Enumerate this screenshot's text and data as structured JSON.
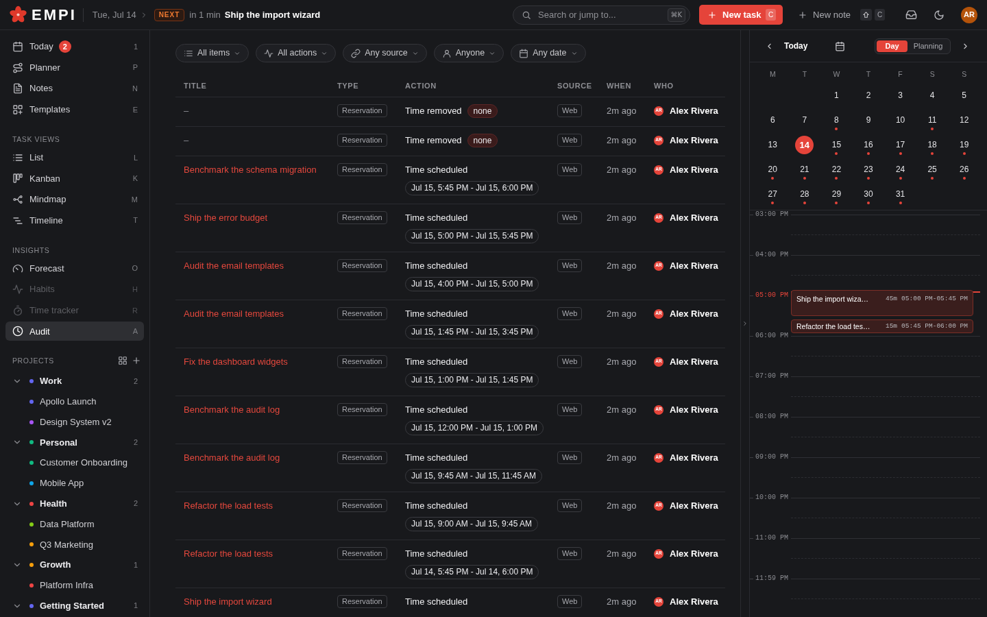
{
  "top_bar": {
    "logo": "EMPI",
    "date": "Tue, Jul 14",
    "next_badge": "NEXT",
    "next_eta": "in 1 min",
    "next_title": "Ship the import wizard",
    "search": {
      "placeholder": "Search or jump to...",
      "shortcut": "⌘K"
    },
    "new_task": {
      "label": "New task",
      "shortcut": "C"
    },
    "new_note": {
      "label": "New note",
      "shortcut": "C"
    },
    "avatar": "AR"
  },
  "sidebar": {
    "items": [
      {
        "label": "Today",
        "badge": "2",
        "shortcut": "1",
        "selected": false,
        "disabled": false
      },
      {
        "label": "Planner",
        "shortcut": "P",
        "selected": false,
        "disabled": false
      },
      {
        "label": "Notes",
        "shortcut": "N",
        "selected": false,
        "disabled": false
      },
      {
        "label": "Templates",
        "shortcut": "E",
        "selected": false,
        "disabled": false
      }
    ],
    "sections": [
      {
        "title": "TASK VIEWS",
        "items": [
          {
            "label": "List",
            "shortcut": "L",
            "selected": false,
            "disabled": false
          },
          {
            "label": "Kanban",
            "shortcut": "K",
            "selected": false,
            "disabled": false
          },
          {
            "label": "Mindmap",
            "shortcut": "M",
            "selected": false,
            "disabled": false
          },
          {
            "label": "Timeline",
            "shortcut": "T",
            "selected": false,
            "disabled": false
          }
        ]
      },
      {
        "title": "INSIGHTS",
        "items": [
          {
            "label": "Forecast",
            "shortcut": "O",
            "selected": false,
            "disabled": false
          },
          {
            "label": "Habits",
            "shortcut": "H",
            "selected": false,
            "disabled": true
          },
          {
            "label": "Time tracker",
            "shortcut": "R",
            "selected": false,
            "disabled": true
          },
          {
            "label": "Audit",
            "shortcut": "A",
            "selected": true,
            "disabled": false
          }
        ]
      }
    ],
    "projects": {
      "title": "PROJECTS",
      "items": [
        {
          "label": "Work",
          "color": "#6366f1",
          "count": "2",
          "expanded": true,
          "children": [
            {
              "label": "Apollo Launch",
              "color": "#6366f1"
            },
            {
              "label": "Design System v2",
              "color": "#a855f7"
            }
          ]
        },
        {
          "label": "Personal",
          "color": "#10b981",
          "count": "2",
          "expanded": true,
          "children": [
            {
              "label": "Customer Onboarding",
              "color": "#10b981"
            },
            {
              "label": "Mobile App",
              "color": "#0ea5e9"
            }
          ]
        },
        {
          "label": "Health",
          "color": "#ef4444",
          "count": "2",
          "expanded": true,
          "children": [
            {
              "label": "Data Platform",
              "color": "#84cc16"
            },
            {
              "label": "Q3 Marketing",
              "color": "#f59e0b"
            }
          ]
        },
        {
          "label": "Growth",
          "color": "#f59e0b",
          "count": "1",
          "expanded": true,
          "children": [
            {
              "label": "Platform Infra",
              "color": "#ef4444"
            }
          ]
        },
        {
          "label": "Getting Started",
          "color": "#6366f1",
          "count": "1",
          "expanded": true
        }
      ]
    }
  },
  "filters": [
    {
      "label": "All items"
    },
    {
      "label": "All actions"
    },
    {
      "label": "Any source"
    },
    {
      "label": "Anyone"
    },
    {
      "label": "Any date"
    }
  ],
  "table": {
    "columns": [
      "TITLE",
      "TYPE",
      "ACTION",
      "SOURCE",
      "WHEN",
      "WHO"
    ],
    "rows": [
      {
        "title": "–",
        "linked": false,
        "type": "Reservation",
        "action": "Time removed",
        "detail": {
          "kind": "value",
          "text": "none"
        },
        "source": "Web",
        "when": "2m ago",
        "who": {
          "initials": "AR",
          "name": "Alex Rivera"
        }
      },
      {
        "title": "–",
        "linked": false,
        "type": "Reservation",
        "action": "Time removed",
        "detail": {
          "kind": "value",
          "text": "none"
        },
        "source": "Web",
        "when": "2m ago",
        "who": {
          "initials": "AR",
          "name": "Alex Rivera"
        }
      },
      {
        "title": "Benchmark the schema migration",
        "linked": true,
        "type": "Reservation",
        "action": "Time scheduled",
        "detail": {
          "kind": "range",
          "text": "Jul 15, 5:45 PM - Jul 15, 6:00 PM"
        },
        "source": "Web",
        "when": "2m ago",
        "who": {
          "initials": "AR",
          "name": "Alex Rivera"
        }
      },
      {
        "title": "Ship the error budget",
        "linked": true,
        "type": "Reservation",
        "action": "Time scheduled",
        "detail": {
          "kind": "range",
          "text": "Jul 15, 5:00 PM - Jul 15, 5:45 PM"
        },
        "source": "Web",
        "when": "2m ago",
        "who": {
          "initials": "AR",
          "name": "Alex Rivera"
        }
      },
      {
        "title": "Audit the email templates",
        "linked": true,
        "type": "Reservation",
        "action": "Time scheduled",
        "detail": {
          "kind": "range",
          "text": "Jul 15, 4:00 PM - Jul 15, 5:00 PM"
        },
        "source": "Web",
        "when": "2m ago",
        "who": {
          "initials": "AR",
          "name": "Alex Rivera"
        }
      },
      {
        "title": "Audit the email templates",
        "linked": true,
        "type": "Reservation",
        "action": "Time scheduled",
        "detail": {
          "kind": "range",
          "text": "Jul 15, 1:45 PM - Jul 15, 3:45 PM"
        },
        "source": "Web",
        "when": "2m ago",
        "who": {
          "initials": "AR",
          "name": "Alex Rivera"
        }
      },
      {
        "title": "Fix the dashboard widgets",
        "linked": true,
        "type": "Reservation",
        "action": "Time scheduled",
        "detail": {
          "kind": "range",
          "text": "Jul 15, 1:00 PM - Jul 15, 1:45 PM"
        },
        "source": "Web",
        "when": "2m ago",
        "who": {
          "initials": "AR",
          "name": "Alex Rivera"
        }
      },
      {
        "title": "Benchmark the audit log",
        "linked": true,
        "type": "Reservation",
        "action": "Time scheduled",
        "detail": {
          "kind": "range",
          "text": "Jul 15, 12:00 PM - Jul 15, 1:00 PM"
        },
        "source": "Web",
        "when": "2m ago",
        "who": {
          "initials": "AR",
          "name": "Alex Rivera"
        }
      },
      {
        "title": "Benchmark the audit log",
        "linked": true,
        "type": "Reservation",
        "action": "Time scheduled",
        "detail": {
          "kind": "range",
          "text": "Jul 15, 9:45 AM - Jul 15, 11:45 AM"
        },
        "source": "Web",
        "when": "2m ago",
        "who": {
          "initials": "AR",
          "name": "Alex Rivera"
        }
      },
      {
        "title": "Refactor the load tests",
        "linked": true,
        "type": "Reservation",
        "action": "Time scheduled",
        "detail": {
          "kind": "range",
          "text": "Jul 15, 9:00 AM - Jul 15, 9:45 AM"
        },
        "source": "Web",
        "when": "2m ago",
        "who": {
          "initials": "AR",
          "name": "Alex Rivera"
        }
      },
      {
        "title": "Refactor the load tests",
        "linked": true,
        "type": "Reservation",
        "action": "Time scheduled",
        "detail": {
          "kind": "range",
          "text": "Jul 14, 5:45 PM - Jul 14, 6:00 PM"
        },
        "source": "Web",
        "when": "2m ago",
        "who": {
          "initials": "AR",
          "name": "Alex Rivera"
        }
      },
      {
        "title": "Ship the import wizard",
        "linked": true,
        "type": "Reservation",
        "action": "Time scheduled",
        "source": "Web",
        "when": "2m ago",
        "who": {
          "initials": "AR",
          "name": "Alex Rivera"
        }
      }
    ]
  },
  "calendar": {
    "nav_label": "Today",
    "views": [
      {
        "label": "Day",
        "selected": true
      },
      {
        "label": "Planning",
        "selected": false
      }
    ],
    "weekdays": [
      "M",
      "T",
      "W",
      "T",
      "F",
      "S",
      "S"
    ],
    "weeks": [
      [
        {
          "day": "1",
          "selected": false,
          "has_events": false
        },
        {
          "day": "2",
          "selected": false,
          "has_events": false
        },
        {
          "day": "3",
          "selected": false,
          "has_events": false
        },
        {
          "day": "4",
          "selected": false,
          "has_events": false
        },
        {
          "day": "5",
          "selected": false,
          "has_events": false
        }
      ],
      [
        {
          "day": "6",
          "selected": false,
          "has_events": false
        },
        {
          "day": "7",
          "selected": false,
          "has_events": false
        },
        {
          "day": "8",
          "selected": false,
          "has_events": true
        },
        {
          "day": "9",
          "selected": false,
          "has_events": false
        },
        {
          "day": "10",
          "selected": false,
          "has_events": false
        },
        {
          "day": "11",
          "selected": false,
          "has_events": true
        },
        {
          "day": "12",
          "selected": false,
          "has_events": false
        }
      ],
      [
        {
          "day": "13",
          "selected": false,
          "has_events": false
        },
        {
          "day": "14",
          "selected": true,
          "has_events": false
        },
        {
          "day": "15",
          "selected": false,
          "has_events": true
        },
        {
          "day": "16",
          "selected": false,
          "has_events": true
        },
        {
          "day": "17",
          "selected": false,
          "has_events": true
        },
        {
          "day": "18",
          "selected": false,
          "has_events": true
        },
        {
          "day": "19",
          "selected": false,
          "has_events": true
        }
      ],
      [
        {
          "day": "20",
          "selected": false,
          "has_events": true
        },
        {
          "day": "21",
          "selected": false,
          "has_events": true
        },
        {
          "day": "22",
          "selected": false,
          "has_events": true
        },
        {
          "day": "23",
          "selected": false,
          "has_events": true
        },
        {
          "day": "24",
          "selected": false,
          "has_events": true
        },
        {
          "day": "25",
          "selected": false,
          "has_events": true
        },
        {
          "day": "26",
          "selected": false,
          "has_events": true
        }
      ],
      [
        {
          "day": "27",
          "selected": false,
          "has_events": true
        },
        {
          "day": "28",
          "selected": false,
          "has_events": true
        },
        {
          "day": "29",
          "selected": false,
          "has_events": true
        },
        {
          "day": "30",
          "selected": false,
          "has_events": true
        },
        {
          "day": "31",
          "selected": false,
          "has_events": true
        }
      ]
    ]
  },
  "timeline": {
    "hours": [
      {
        "label": "03:00 PM",
        "current": false
      },
      {
        "label": "04:00 PM",
        "current": false
      },
      {
        "label": "05:00 PM",
        "current": true,
        "events": [
          {
            "kind": "long",
            "title": "Ship the import wiza…",
            "duration": "45m",
            "time": "05:00 PM-05:45 PM"
          },
          {
            "kind": "short",
            "title": "Refactor the load tes…",
            "duration": "15m",
            "time": "05:45 PM-06:00 PM"
          }
        ]
      },
      {
        "label": "06:00 PM",
        "current": false
      },
      {
        "label": "07:00 PM",
        "current": false
      },
      {
        "label": "08:00 PM",
        "current": false
      },
      {
        "label": "09:00 PM",
        "current": false
      },
      {
        "label": "10:00 PM",
        "current": false
      },
      {
        "label": "11:00 PM",
        "current": false
      },
      {
        "label": "11:59 PM",
        "current": false
      }
    ]
  }
}
